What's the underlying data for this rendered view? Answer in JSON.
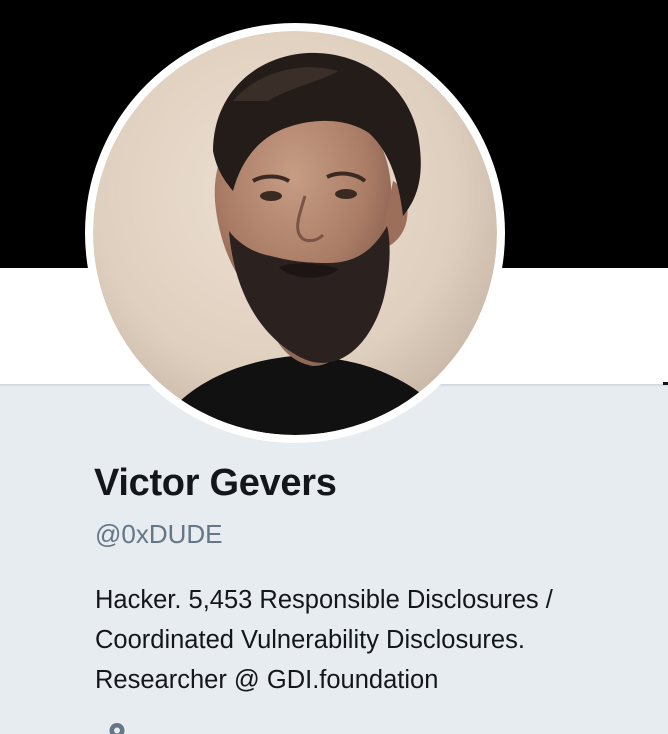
{
  "profile": {
    "name": "Victor Gevers",
    "handle": "@0xDUDE",
    "bio": {
      "line1": "Hacker. 5,453 Responsible Disclosures /",
      "line2": "Coordinated Vulnerability Disclosures.",
      "line3_prefix": "Researcher @ ",
      "line3_link": "GDI.foundation"
    },
    "avatar_icon": "profile-photo"
  },
  "colors": {
    "banner": "#000000",
    "panel_background": "#e6ecf0",
    "name_text": "#14171a",
    "handle_text": "#657786"
  }
}
